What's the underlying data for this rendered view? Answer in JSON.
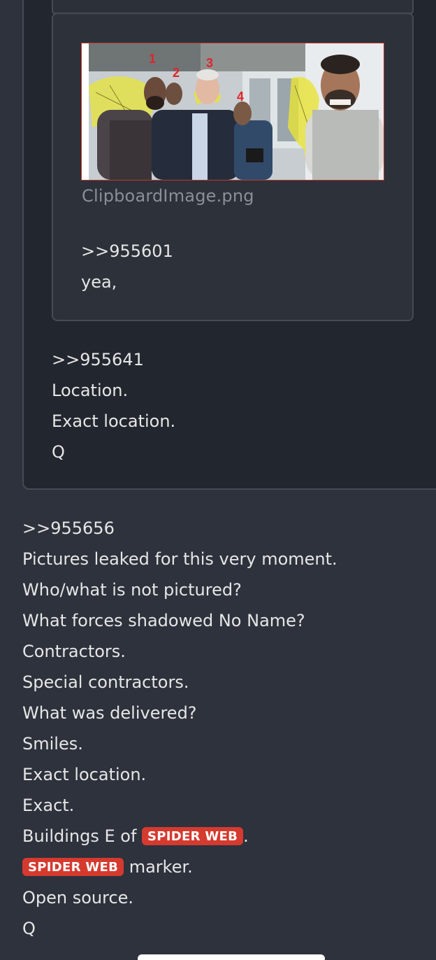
{
  "inner_post": {
    "image_filename": "ClipboardImage.png",
    "image_alt": "photo",
    "annotation_numbers": [
      "1",
      "2",
      "3",
      "4"
    ],
    "lines": [
      ">>955601",
      "yea,"
    ]
  },
  "outer_post": {
    "lines": [
      ">>955641",
      "Location.",
      "Exact location.",
      "Q"
    ]
  },
  "main_post": {
    "lines": [
      ">>955656",
      "Pictures leaked for this very moment.",
      "Who/what is not pictured?",
      "What forces shadowed No Name?",
      "Contractors.",
      "Special contractors.",
      "What was delivered?",
      "Smiles.",
      "Exact location.",
      "Exact."
    ],
    "buildings_prefix": "Buildings E of ",
    "buildings_suffix": ".",
    "marker_suffix": " marker.",
    "badge_text": "SPIDER WEB",
    "tail_lines": [
      "Open source.",
      "Q"
    ]
  },
  "colors": {
    "background": "#2d323c",
    "quote_background": "#22262e",
    "badge": "#d53a2f",
    "annotation": "#e0252a"
  }
}
